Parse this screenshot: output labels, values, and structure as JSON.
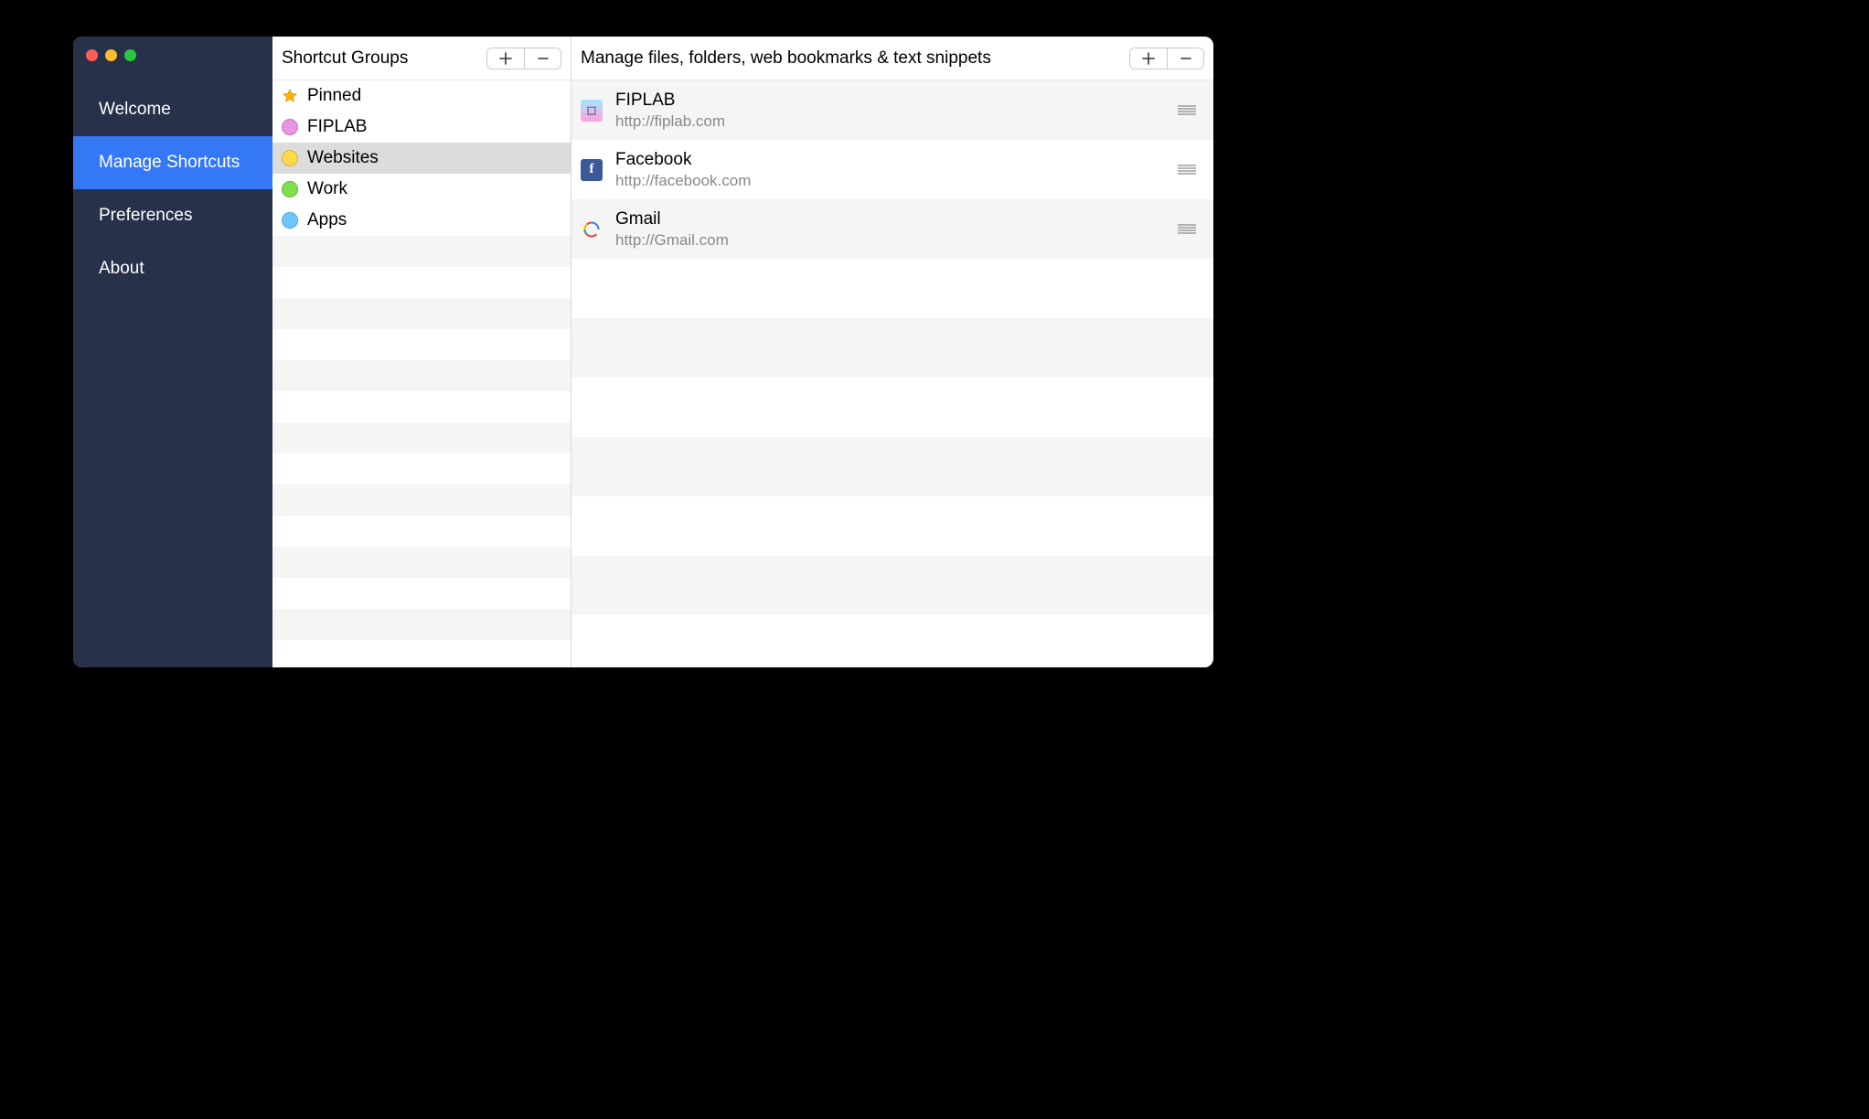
{
  "sidebar": {
    "items": [
      {
        "label": "Welcome",
        "active": false
      },
      {
        "label": "Manage Shortcuts",
        "active": true
      },
      {
        "label": "Preferences",
        "active": false
      },
      {
        "label": "About",
        "active": false
      }
    ]
  },
  "groups": {
    "title": "Shortcut Groups",
    "items": [
      {
        "label": "Pinned",
        "icon": "star",
        "selected": false
      },
      {
        "label": "FIPLAB",
        "icon": "pink",
        "selected": false
      },
      {
        "label": "Websites",
        "icon": "yellow",
        "selected": true
      },
      {
        "label": "Work",
        "icon": "green",
        "selected": false
      },
      {
        "label": "Apps",
        "icon": "blue",
        "selected": false
      }
    ]
  },
  "shortcuts": {
    "title": "Manage files, folders, web bookmarks & text snippets",
    "items": [
      {
        "title": "FIPLAB",
        "url": "http://fiplab.com",
        "fav": "fiplab"
      },
      {
        "title": "Facebook",
        "url": "http://facebook.com",
        "fav": "facebook"
      },
      {
        "title": "Gmail",
        "url": "http://Gmail.com",
        "fav": "gmail"
      }
    ]
  }
}
